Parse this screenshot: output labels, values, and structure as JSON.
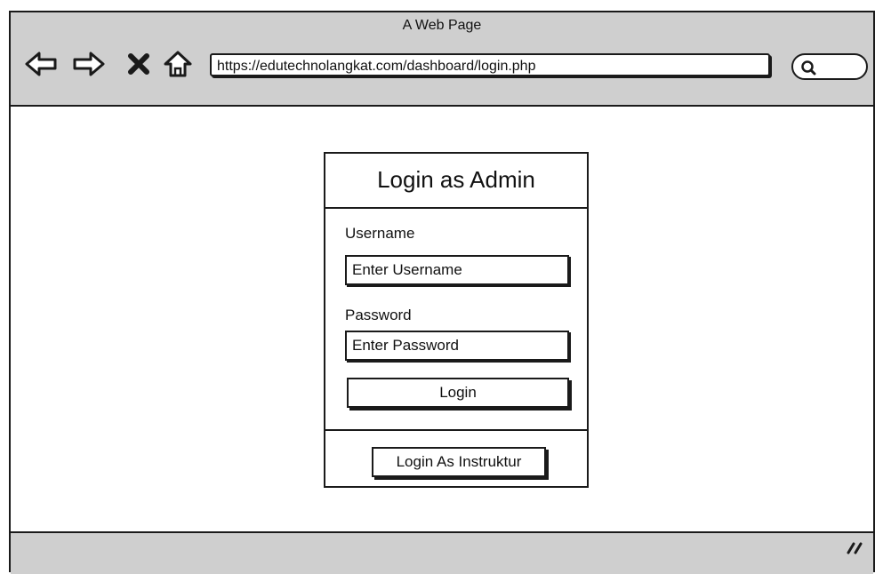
{
  "browser": {
    "window_title": "A Web Page",
    "url": "https://edutechnolangkat.com/dashboard/login.php",
    "nav_icons": [
      "back-arrow-icon",
      "forward-arrow-icon",
      "stop-icon",
      "home-icon"
    ],
    "search_icon": "search-icon"
  },
  "login_panel": {
    "title": "Login as Admin",
    "username_label": "Username",
    "username_placeholder": "Enter Username",
    "password_label": "Password",
    "password_placeholder": "Enter Password",
    "login_button": "Login",
    "alt_login_button": "Login As Instruktur"
  }
}
